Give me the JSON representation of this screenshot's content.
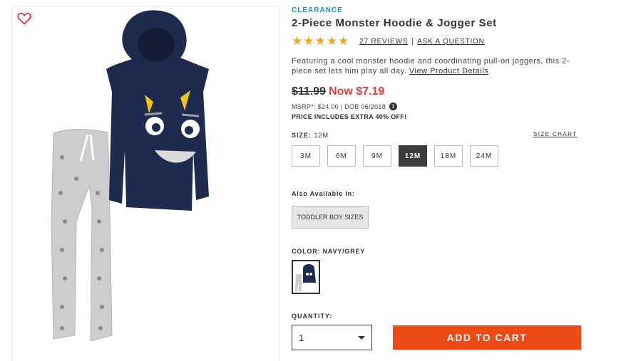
{
  "product": {
    "badge": "CLEARANCE",
    "title": "2-Piece Monster Hoodie & Jogger Set",
    "stars": "★★★★★",
    "rating_value": 5,
    "reviews_link": "27 REVIEWS",
    "separator": "|",
    "ask_link": "ASK A QUESTION",
    "description": "Featuring a cool monster hoodie and coordinating pull-on joggers, this 2-piece set lets him play all day.",
    "details_link": "View Product Details"
  },
  "price": {
    "original": "$11.99",
    "now": "Now $7.19",
    "msrp": "MSRP*: $24.00 | DOB 06/2018",
    "info_icon": "i",
    "promo": "PRICE INCLUDES EXTRA 40% OFF!"
  },
  "size": {
    "label": "SIZE:",
    "selected": "12M",
    "chart_link": "SIZE CHART",
    "options": [
      "3M",
      "6M",
      "9M",
      "12M",
      "18M",
      "24M"
    ]
  },
  "also_available": {
    "label": "Also Available In:",
    "button": "TODDLER BOY SIZES"
  },
  "color": {
    "label": "COLOR: NAVY/GREY"
  },
  "quantity": {
    "label": "QUANTITY:",
    "value": "1"
  },
  "cart": {
    "button": "ADD TO CART"
  },
  "icons": {
    "wishlist": "heart-outline-icon",
    "dropdown": "chevron-down-icon"
  },
  "colors": {
    "accent_blue": "#2b8ec4",
    "sale_red": "#e63a3a",
    "star_gold": "#f0a818",
    "cta_orange": "#ee4a16",
    "hoodie_navy": "#1e2a4e",
    "jogger_grey": "#cfcfcf"
  }
}
